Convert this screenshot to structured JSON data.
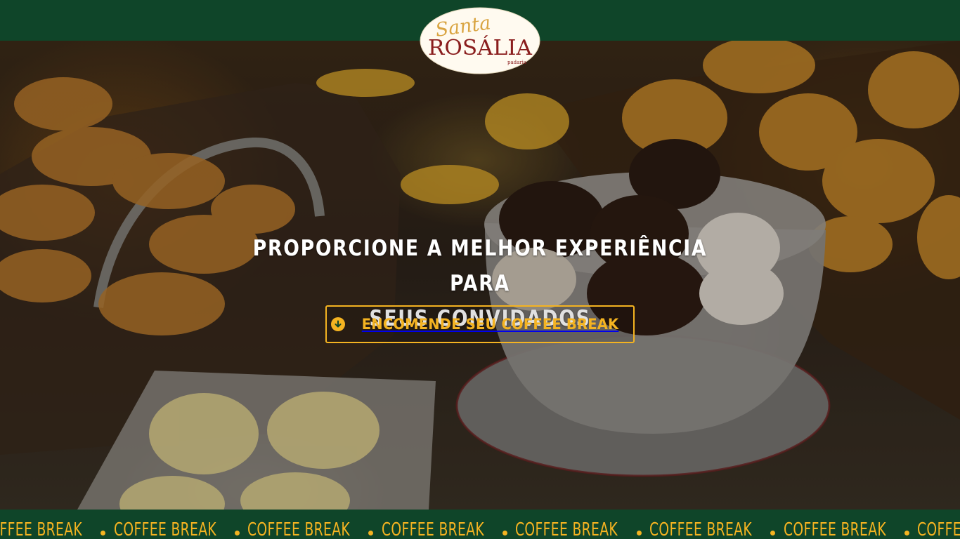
{
  "brand": {
    "script_name": "Santa",
    "main_name": "ROSÁLIA",
    "tagline": "padaria",
    "colors": {
      "green": "#0f4529",
      "gold": "#f4b321",
      "logo_red": "#8a1d1d",
      "logo_cream": "#fffaf0"
    }
  },
  "hero": {
    "headline_part1": "Proporcione a ",
    "headline_bold": "melhor experiência",
    "headline_part2": " para",
    "headline_line2": "seus convidados",
    "image_subject": "coffee-break-pastries-photo"
  },
  "cta": {
    "label": "ENCOMENDE SEU COFFEE BREAK",
    "icon": "arrow-down-circle-icon"
  },
  "marquee": {
    "item_text": "COFFEE BREAK",
    "items": [
      "COFFEE BREAK",
      "COFFEE BREAK",
      "COFFEE BREAK",
      "COFFEE BREAK",
      "COFFEE BREAK",
      "COFFEE BREAK",
      "COFFEE BREAK",
      "COFFEE BREAK"
    ]
  }
}
